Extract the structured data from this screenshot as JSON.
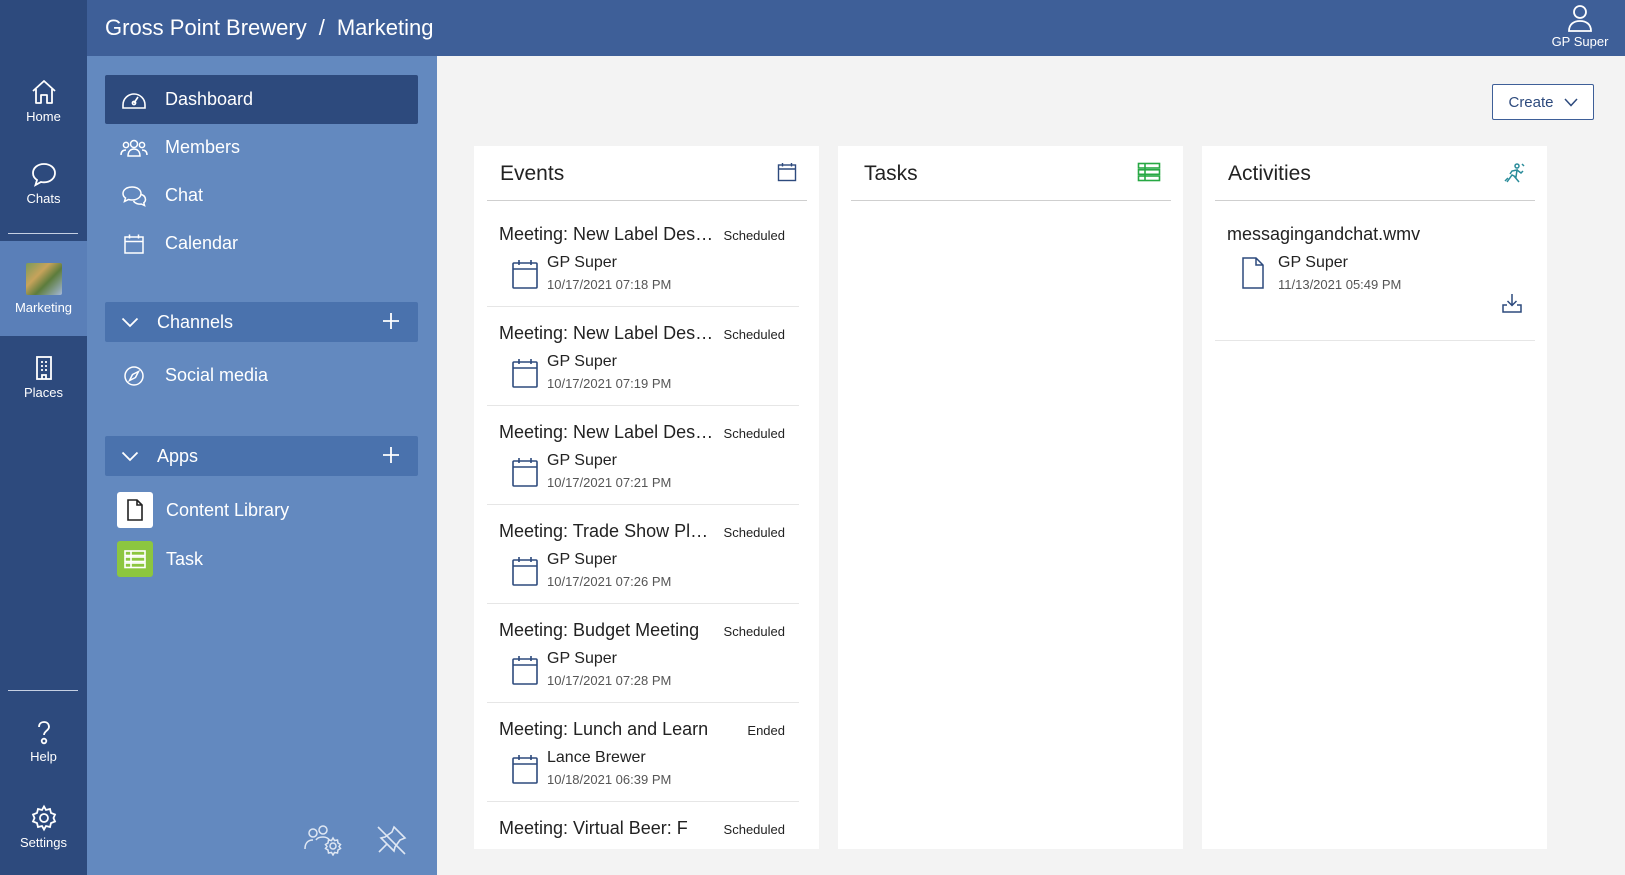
{
  "rail": {
    "items": [
      {
        "label": "Home",
        "icon": "home-icon"
      },
      {
        "label": "Chats",
        "icon": "chat-bubble-icon"
      },
      {
        "label": "Marketing",
        "icon": "marketing-avatar"
      },
      {
        "label": "Places",
        "icon": "building-icon"
      },
      {
        "label": "Help",
        "icon": "help-icon"
      },
      {
        "label": "Settings",
        "icon": "gear-icon"
      }
    ]
  },
  "topbar": {
    "org": "Gross Point Brewery",
    "separator": "/",
    "group": "Marketing",
    "user": "GP Super"
  },
  "sidebar": {
    "nav": [
      {
        "label": "Dashboard",
        "icon": "dashboard-icon"
      },
      {
        "label": "Members",
        "icon": "members-icon"
      },
      {
        "label": "Chat",
        "icon": "chat-icon"
      },
      {
        "label": "Calendar",
        "icon": "calendar-icon"
      }
    ],
    "channels": {
      "label": "Channels",
      "items": [
        {
          "label": "Social media",
          "icon": "compass-icon"
        }
      ]
    },
    "apps": {
      "label": "Apps",
      "items": [
        {
          "label": "Content Library",
          "icon": "document-icon"
        },
        {
          "label": "Task",
          "icon": "task-icon"
        }
      ]
    }
  },
  "main": {
    "create_label": "Create",
    "events": {
      "title": "Events",
      "items": [
        {
          "title": "Meeting: New Label Design",
          "status": "Scheduled",
          "owner": "GP Super",
          "date": "10/17/2021 07:18 PM"
        },
        {
          "title": "Meeting: New Label Design",
          "status": "Scheduled",
          "owner": "GP Super",
          "date": "10/17/2021 07:19 PM"
        },
        {
          "title": "Meeting: New Label Design",
          "status": "Scheduled",
          "owner": "GP Super",
          "date": "10/17/2021 07:21 PM"
        },
        {
          "title": "Meeting: Trade Show Planning",
          "status": "Scheduled",
          "owner": "GP Super",
          "date": "10/17/2021 07:26 PM"
        },
        {
          "title": "Meeting: Budget Meeting",
          "status": "Scheduled",
          "owner": "GP Super",
          "date": "10/17/2021 07:28 PM"
        },
        {
          "title": "Meeting: Lunch and Learn",
          "status": "Ended",
          "owner": "Lance Brewer",
          "date": "10/18/2021 06:39 PM"
        },
        {
          "title": "Meeting: Virtual Beer: F",
          "status": "Scheduled",
          "owner": "",
          "date": ""
        }
      ]
    },
    "tasks": {
      "title": "Tasks"
    },
    "activities": {
      "title": "Activities",
      "items": [
        {
          "title": "messagingandchat.wmv",
          "owner": "GP Super",
          "date": "11/13/2021 05:49 PM"
        }
      ]
    }
  },
  "colors": {
    "rail": "#2d4a7d",
    "topbar": "#3e5f98",
    "sidebar": "#6389bf",
    "active": "#2d4a7d",
    "task_green": "#8cc63f",
    "tasks_icon_green": "#27a844",
    "activity_icon_teal": "#2a8c9a"
  }
}
